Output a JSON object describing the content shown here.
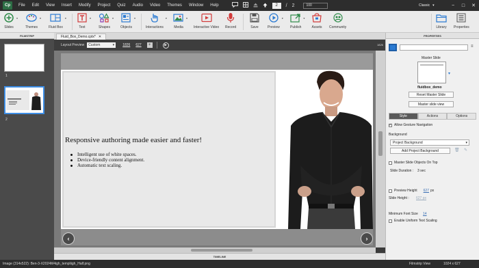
{
  "app": {
    "logo_text": "Cp",
    "menus": [
      "File",
      "Edit",
      "View",
      "Insert",
      "Modify",
      "Project",
      "Quiz",
      "Audio",
      "Video",
      "Themes",
      "Window",
      "Help"
    ],
    "current_page": "2",
    "page_separator": "/",
    "total_pages": "2",
    "zoom": "100",
    "workspace": "Classic",
    "window_minimize": "−",
    "window_maximize": "□",
    "window_close": "✕"
  },
  "toolbar": {
    "slides": "Slides",
    "themes": "Themes",
    "fluid_box": "Fluid Box",
    "text": "Text",
    "shapes": "Shapes",
    "objects": "Objects",
    "interactions": "Interactions",
    "media": "Media",
    "interactive_video": "Interactive Video",
    "record": "Record",
    "save": "Save",
    "preview": "Preview",
    "publish": "Publish",
    "assets": "Assets",
    "community": "Community",
    "library": "Library",
    "properties": "Properties",
    "dropdown_glyph": "▾",
    "colors": {
      "blue": "#2a7ad2",
      "green": "#2d8a48",
      "red": "#d23a3a",
      "purple": "#8a3ab0",
      "gray": "#555555"
    }
  },
  "filmstrip": {
    "title": "FILMSTRIP",
    "slides": [
      {
        "number": "1",
        "selected": false
      },
      {
        "number": "2",
        "selected": true
      }
    ]
  },
  "document": {
    "tab_name": "Fluid_Box_Demo.cptx*",
    "tab_close": "✕"
  },
  "layout_bar": {
    "label": "Layout Preview",
    "preset": "Custom",
    "width": "1826",
    "height": "627",
    "add_symbol": "+",
    "play_symbol": "▶",
    "ruler_value": "1826"
  },
  "slide": {
    "heading": "Responsive authoring made easier and faster!",
    "bullets": [
      "Intelligent use of white spaces.",
      "Device-friendly content alignment.",
      "Automatic text scaling."
    ],
    "prev_symbol": "‹",
    "next_symbol": "›"
  },
  "timeline": {
    "title": "TIMELINE"
  },
  "properties": {
    "title": "PROPERTIES",
    "master_slide_label": "Master Slide",
    "master_slide_name": "fluidbox_demo",
    "reset_master_slide": "Reset Master Slide",
    "master_slide_view": "Master slide view",
    "tabs": [
      {
        "label": "Style",
        "active": true
      },
      {
        "label": "Actions",
        "active": false
      },
      {
        "label": "Options",
        "active": false
      }
    ],
    "allow_gesture_navigation": {
      "label": "Allow Gesture Navigation",
      "checked": true
    },
    "background_label": "Background",
    "background_value": "Project Background",
    "add_project_background": "Add Project Background",
    "master_slide_objects_on_top": {
      "label": "Master Slide Objects On Top",
      "checked": false
    },
    "slide_duration_label": "Slide Duration :",
    "slide_duration_value": "3 sec",
    "preview_height": {
      "label": "Preview Height",
      "checked": false,
      "value": "627",
      "unit": "px"
    },
    "slide_height_label": "Slide Height :",
    "slide_height_value": "627 px",
    "minimum_font_size_label": "Minimum Font Size",
    "minimum_font_size_value": "14",
    "enable_uniform_text_scaling": {
      "label": "Enable Uniform Text Scaling",
      "checked": false
    }
  },
  "status": {
    "image_info": "Image (314x522): Ben-3-X2024M4igh_templiigh_Half.png",
    "view": "Filmstrip View",
    "resolution": "1024 x 627"
  }
}
